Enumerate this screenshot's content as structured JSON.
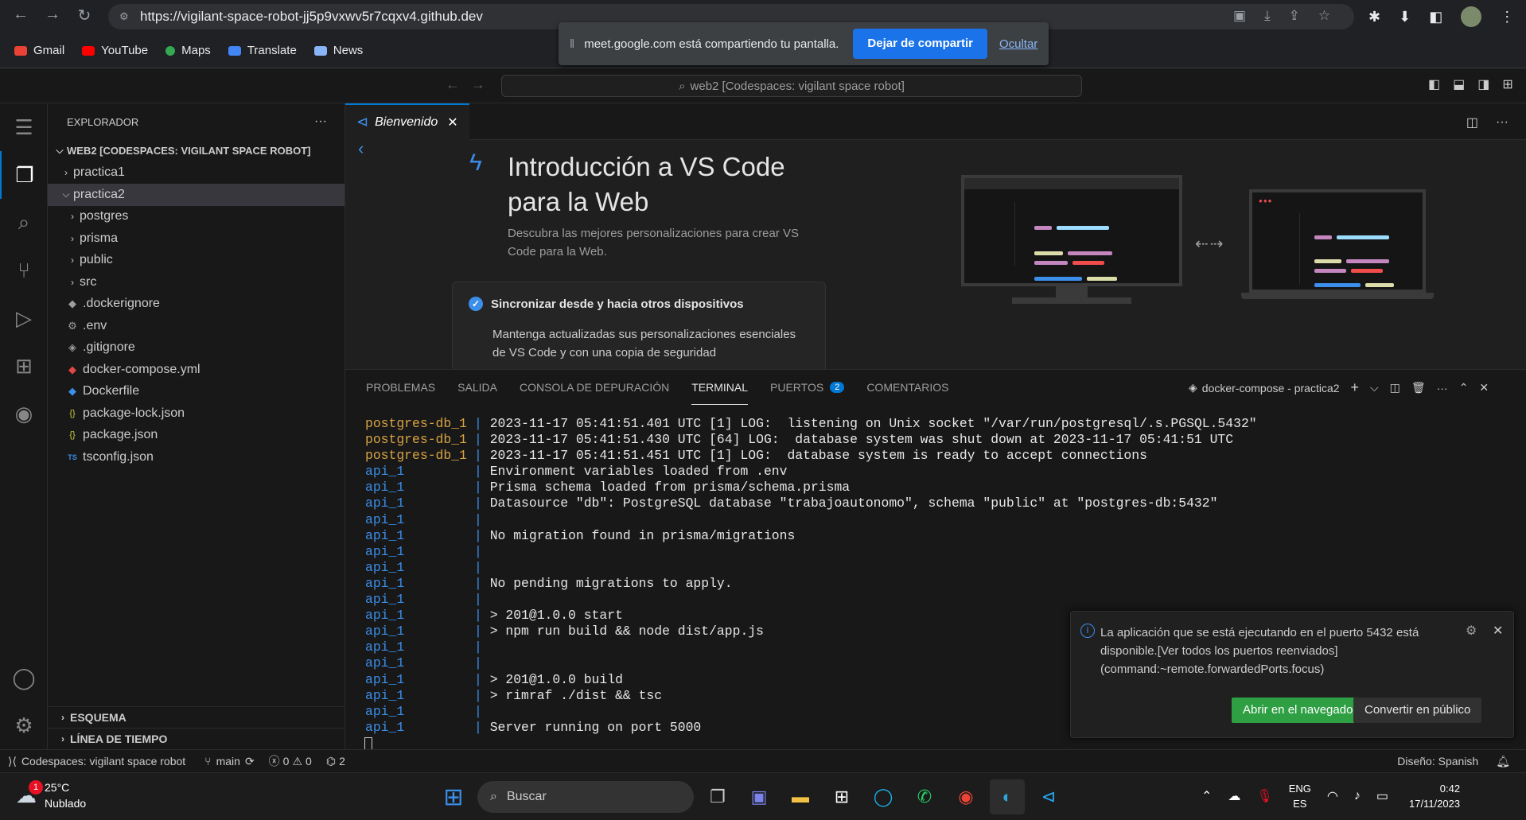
{
  "browser": {
    "url": "https://vigilant-space-robot-jj5p9vxwv5r7cqxv4.github.dev",
    "bookmarks": [
      {
        "label": "Gmail",
        "color": "#ea4335"
      },
      {
        "label": "YouTube",
        "color": "#ff0000"
      },
      {
        "label": "Maps",
        "color": "#34a853"
      },
      {
        "label": "Translate",
        "color": "#4285f4"
      },
      {
        "label": "News",
        "color": "#8ab4f8"
      }
    ],
    "share_bar": {
      "message": "meet.google.com está compartiendo tu pantalla.",
      "stop_label": "Dejar de compartir",
      "hide_label": "Ocultar"
    }
  },
  "vscode": {
    "command_center": "web2 [Codespaces: vigilant space robot]",
    "explorer": {
      "header": "EXPLORADOR",
      "root": "WEB2 [CODESPACES: VIGILANT SPACE ROBOT]",
      "items": [
        {
          "label": "practica1",
          "type": "folder",
          "level": 0,
          "open": false
        },
        {
          "label": "practica2",
          "type": "folder",
          "level": 0,
          "open": true,
          "selected": true
        },
        {
          "label": "postgres",
          "type": "folder",
          "level": 1,
          "open": false
        },
        {
          "label": "prisma",
          "type": "folder",
          "level": 1,
          "open": false
        },
        {
          "label": "public",
          "type": "folder",
          "level": 1,
          "open": false
        },
        {
          "label": "src",
          "type": "folder",
          "level": 1,
          "open": false
        },
        {
          "label": ".dockerignore",
          "type": "file",
          "level": 1,
          "icon": "docker-icon",
          "icon_color": "#9d9d9d"
        },
        {
          "label": ".env",
          "type": "file",
          "level": 1,
          "icon": "gear-icon",
          "icon_color": "#9d9d9d"
        },
        {
          "label": ".gitignore",
          "type": "file",
          "level": 1,
          "icon": "git-icon",
          "icon_color": "#9d9d9d"
        },
        {
          "label": "docker-compose.yml",
          "type": "file",
          "level": 1,
          "icon": "docker-icon",
          "icon_color": "#e24747"
        },
        {
          "label": "Dockerfile",
          "type": "file",
          "level": 1,
          "icon": "docker-icon",
          "icon_color": "#3b8eea"
        },
        {
          "label": "package-lock.json",
          "type": "file",
          "level": 1,
          "icon": "json-icon",
          "icon_color": "#cbcb41"
        },
        {
          "label": "package.json",
          "type": "file",
          "level": 1,
          "icon": "json-icon",
          "icon_color": "#cbcb41"
        },
        {
          "label": "tsconfig.json",
          "type": "file",
          "level": 1,
          "icon": "ts-icon",
          "icon_color": "#3b8eea"
        }
      ],
      "sections": [
        "ESQUEMA",
        "LÍNEA DE TIEMPO"
      ]
    },
    "tab": {
      "label": "Bienvenido"
    },
    "welcome": {
      "title": "Introducción a VS Code para la Web",
      "subtitle": "Descubra las mejores personalizaciones para crear VS Code para la Web.",
      "card_title": "Sincronizar desde y hacia otros dispositivos",
      "card_desc": "Mantenga actualizadas sus personalizaciones esenciales de VS Code y con una copia de seguridad"
    },
    "panel": {
      "tabs": [
        {
          "label": "PROBLEMAS",
          "active": false
        },
        {
          "label": "SALIDA",
          "active": false
        },
        {
          "label": "CONSOLA DE DEPURACIÓN",
          "active": false
        },
        {
          "label": "TERMINAL",
          "active": true
        },
        {
          "label": "PUERTOS",
          "active": false,
          "badge": "2"
        },
        {
          "label": "COMENTARIOS",
          "active": false
        }
      ],
      "terminal_name": "docker-compose - practica2",
      "lines": [
        {
          "svc": "postgres-db_1",
          "kind": "pg",
          "text": "2023-11-17 05:41:51.401 UTC [1] LOG:  listening on Unix socket \"/var/run/postgresql/.s.PGSQL.5432\""
        },
        {
          "svc": "postgres-db_1",
          "kind": "pg",
          "text": "2023-11-17 05:41:51.430 UTC [64] LOG:  database system was shut down at 2023-11-17 05:41:51 UTC"
        },
        {
          "svc": "postgres-db_1",
          "kind": "pg",
          "text": "2023-11-17 05:41:51.451 UTC [1] LOG:  database system is ready to accept connections"
        },
        {
          "svc": "api_1",
          "kind": "api",
          "text": "Environment variables loaded from .env"
        },
        {
          "svc": "api_1",
          "kind": "api",
          "text": "Prisma schema loaded from prisma/schema.prisma"
        },
        {
          "svc": "api_1",
          "kind": "api",
          "text": "Datasource \"db\": PostgreSQL database \"trabajoautonomo\", schema \"public\" at \"postgres-db:5432\""
        },
        {
          "svc": "api_1",
          "kind": "api",
          "text": ""
        },
        {
          "svc": "api_1",
          "kind": "api",
          "text": "No migration found in prisma/migrations"
        },
        {
          "svc": "api_1",
          "kind": "api",
          "text": ""
        },
        {
          "svc": "api_1",
          "kind": "api",
          "text": ""
        },
        {
          "svc": "api_1",
          "kind": "api",
          "text": "No pending migrations to apply."
        },
        {
          "svc": "api_1",
          "kind": "api",
          "text": ""
        },
        {
          "svc": "api_1",
          "kind": "api",
          "text": "> 201@1.0.0 start"
        },
        {
          "svc": "api_1",
          "kind": "api",
          "text": "> npm run build && node dist/app.js"
        },
        {
          "svc": "api_1",
          "kind": "api",
          "text": ""
        },
        {
          "svc": "api_1",
          "kind": "api",
          "text": ""
        },
        {
          "svc": "api_1",
          "kind": "api",
          "text": "> 201@1.0.0 build"
        },
        {
          "svc": "api_1",
          "kind": "api",
          "text": "> rimraf ./dist && tsc"
        },
        {
          "svc": "api_1",
          "kind": "api",
          "text": ""
        },
        {
          "svc": "api_1",
          "kind": "api",
          "text": "Server running on port 5000"
        }
      ]
    },
    "notification": {
      "text": "La aplicación que se está ejecutando en el puerto 5432 está disponible.[Ver todos los puertos reenviados](command:~remote.forwardedPorts.focus)",
      "primary": "Abrir en el navegador",
      "secondary": "Convertir en público"
    },
    "status": {
      "remote": "Codespaces: vigilant space robot",
      "branch": "main",
      "errors": "0",
      "warnings": "0",
      "ports": "2",
      "layout": "Diseño: Spanish"
    }
  },
  "taskbar": {
    "weather_temp": "25°C",
    "weather_desc": "Nublado",
    "weather_badge": "1",
    "search_placeholder": "Buscar",
    "lang_top": "ENG",
    "lang_bottom": "ES",
    "time": "0:42",
    "date": "17/11/2023"
  }
}
